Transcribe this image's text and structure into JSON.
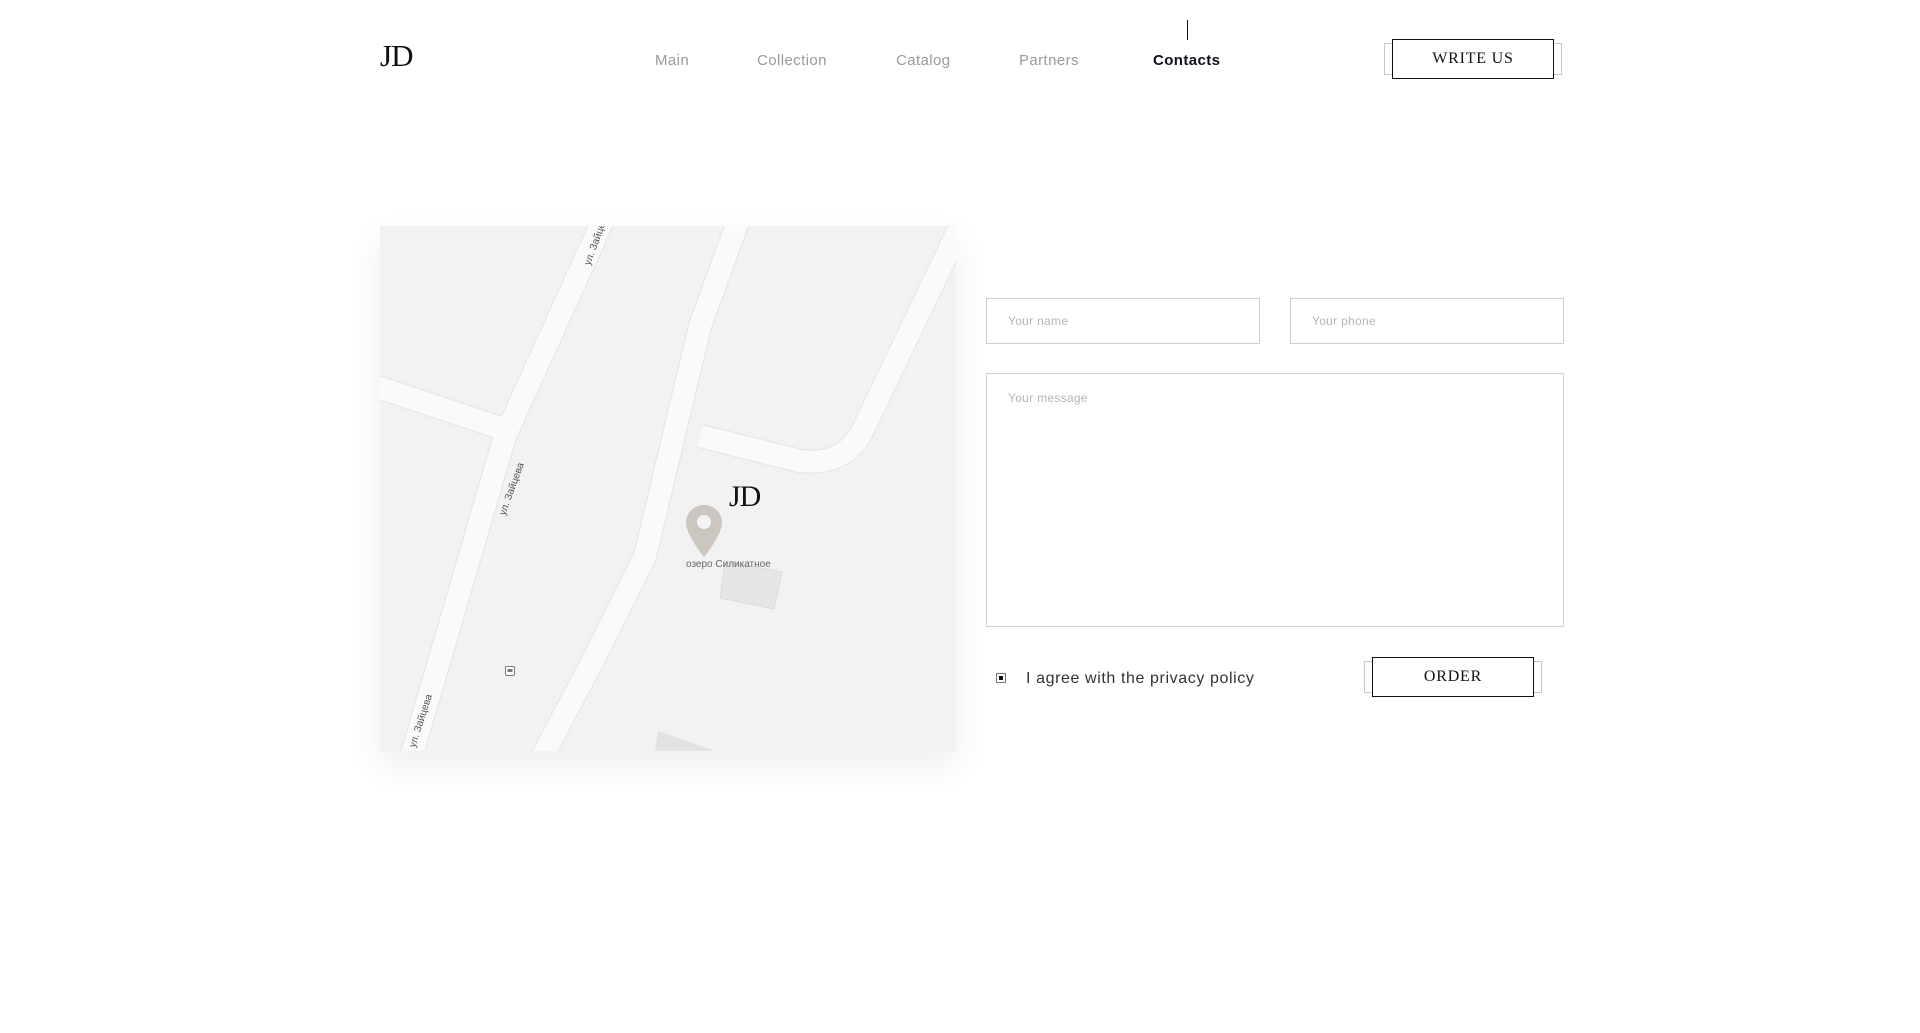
{
  "header": {
    "logo": "JD",
    "nav": [
      {
        "label": "Main"
      },
      {
        "label": "Collection"
      },
      {
        "label": "Catalog"
      },
      {
        "label": "Partners"
      },
      {
        "label": "Contacts",
        "active": true
      }
    ],
    "write_us_label": "WRITE US"
  },
  "map": {
    "marker_logo": "JD",
    "place_label": "озеро Силикатное",
    "street_labels": [
      "ул. Зайцева",
      "ул. Зайцева",
      "ул. Зайцева"
    ],
    "pin_icon": "map-pin-icon",
    "poi_icon": "bus-stop-icon"
  },
  "form": {
    "name_placeholder": "Your name",
    "phone_placeholder": "Your phone",
    "message_placeholder": "Your message",
    "agree_label": "I agree with the privacy policy",
    "agree_checked": true,
    "order_label": "ORDER"
  },
  "colors": {
    "background": "#ffffff",
    "map_background": "#f2f2f2",
    "road": "#fafafa",
    "accent_text": "#111111",
    "muted_text": "#9a9a9a"
  }
}
